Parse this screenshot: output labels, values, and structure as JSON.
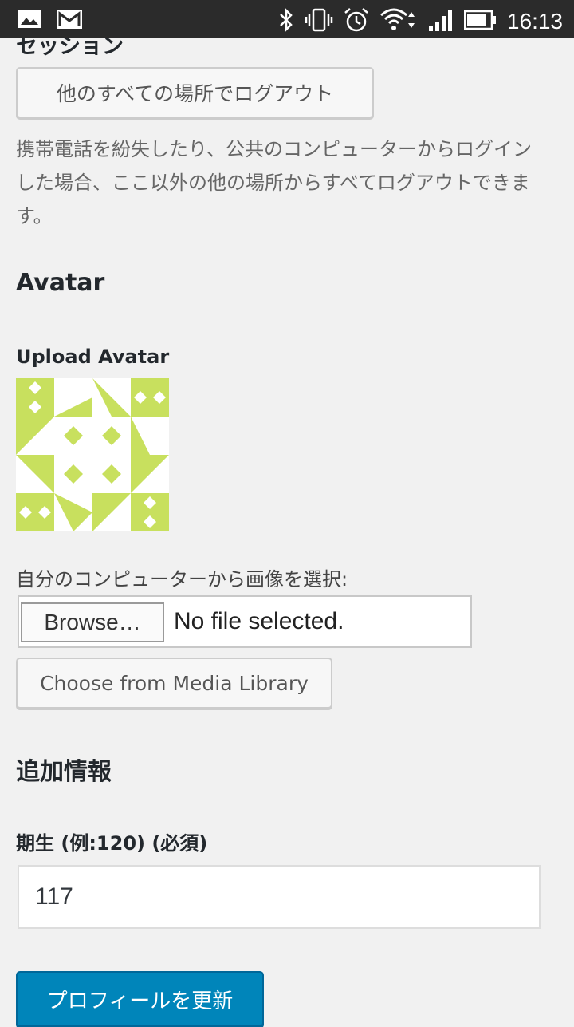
{
  "status_bar": {
    "time": "16:13",
    "left_icons": [
      "image-icon",
      "gmail-icon"
    ],
    "right_icons": [
      "bluetooth-icon",
      "vibrate-icon",
      "alarm-icon",
      "wifi-icon",
      "signal-icon",
      "battery-icon"
    ]
  },
  "sessions": {
    "title": "セッション",
    "logout_button": "他のすべての場所でログアウト",
    "description": "携帯電話を紛失したり、公共のコンピューターからログインした場合、ここ以外の他の場所からすべてログアウトできます。"
  },
  "avatar": {
    "heading": "Avatar",
    "upload_label": "Upload Avatar",
    "avatar_color": "#c8e05e",
    "choose_label": "自分のコンピューターから画像を選択:",
    "browse_button": "Browse…",
    "file_status": "No file selected.",
    "media_button": "Choose from Media Library"
  },
  "extra": {
    "heading": "追加情報",
    "field_label": "期生 (例:120) (必須)",
    "field_value": "117"
  },
  "submit": {
    "label": "プロフィールを更新",
    "color": "#0085ba"
  }
}
